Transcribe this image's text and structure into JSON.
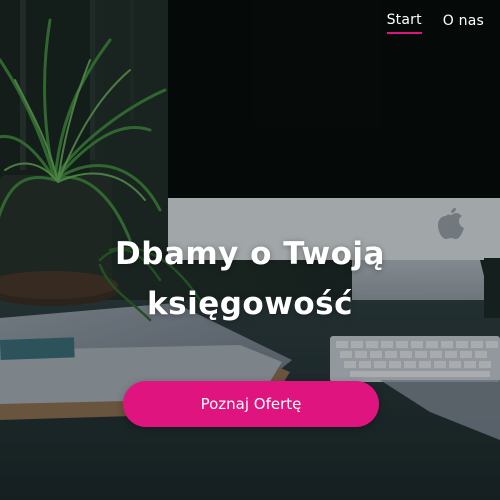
{
  "nav": {
    "items": [
      {
        "label": "Start",
        "active": true
      },
      {
        "label": "O nas",
        "active": false
      }
    ]
  },
  "hero": {
    "headline_line1": "Dbamy o Twoją",
    "headline_line2": "księgowość",
    "cta_label": "Poznaj Ofertę"
  },
  "colors": {
    "accent": "#e0147f",
    "text": "#ffffff"
  },
  "icons": {
    "monitor_logo": "apple-logo-icon"
  }
}
